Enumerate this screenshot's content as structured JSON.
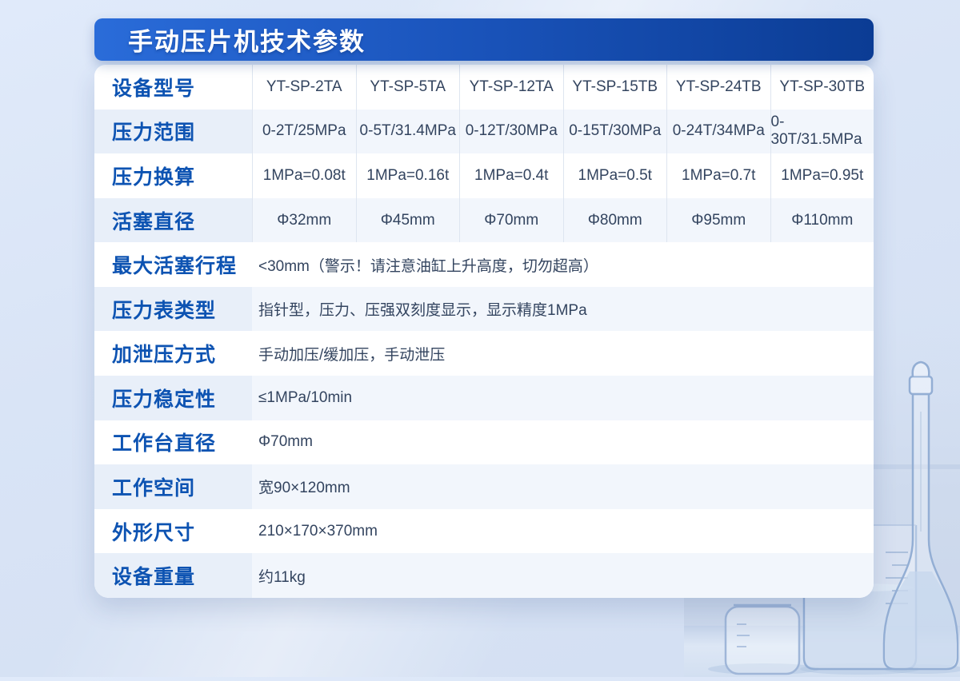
{
  "header": {
    "title": "手动压片机技术参数"
  },
  "table": {
    "rows": [
      {
        "label": "设备型号",
        "values": [
          "YT-SP-2TA",
          "YT-SP-5TA",
          "YT-SP-12TA",
          "YT-SP-15TB",
          "YT-SP-24TB",
          "YT-SP-30TB"
        ]
      },
      {
        "label": "压力范围",
        "values": [
          "0-2T/25MPa",
          "0-5T/31.4MPa",
          "0-12T/30MPa",
          "0-15T/30MPa",
          "0-24T/34MPa",
          "0-30T/31.5MPa"
        ]
      },
      {
        "label": "压力换算",
        "values": [
          "1MPa=0.08t",
          "1MPa=0.16t",
          "1MPa=0.4t",
          "1MPa=0.5t",
          "1MPa=0.7t",
          "1MPa=0.95t"
        ]
      },
      {
        "label": "活塞直径",
        "values": [
          "Φ32mm",
          "Φ45mm",
          "Φ70mm",
          "Φ80mm",
          "Φ95mm",
          "Φ110mm"
        ]
      },
      {
        "label": "最大活塞行程",
        "value": "<30mm（警示！请注意油缸上升高度，切勿超高）"
      },
      {
        "label": "压力表类型",
        "value": "指针型，压力、压强双刻度显示，显示精度1MPa"
      },
      {
        "label": "加泄压方式",
        "value": "手动加压/缓加压，手动泄压"
      },
      {
        "label": "压力稳定性",
        "value": "≤1MPa/10min"
      },
      {
        "label": "工作台直径",
        "value": "Φ70mm"
      },
      {
        "label": "工作空间",
        "value": "宽90×120mm"
      },
      {
        "label": "外形尺寸",
        "value": "210×170×370mm"
      },
      {
        "label": "设备重量",
        "value": "约11kg"
      }
    ]
  },
  "colors": {
    "bar_gradient_start": "#2a6cd9",
    "bar_gradient_end": "#0b3c94",
    "label_blue": "#0d53b2",
    "value_text": "#33445f",
    "stripe_label_bg": "#e8eff9",
    "stripe_value_bg": "#f2f6fc",
    "page_background": "#d9e4f6",
    "card_background": "#ffffff"
  },
  "decor": {
    "glassware": "laboratory beakers and volumetric flask photo, bottom right"
  }
}
